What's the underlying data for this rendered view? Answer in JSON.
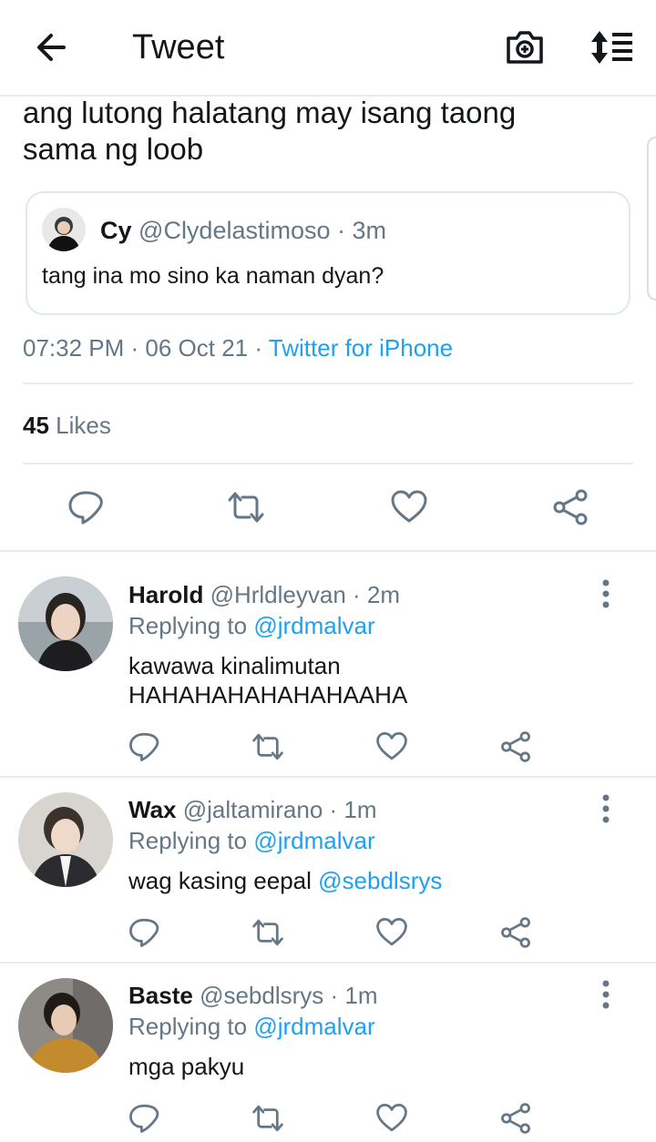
{
  "header": {
    "title": "Tweet"
  },
  "tweet": {
    "text_line1": "ang lutong halatang may isang taong",
    "text_line2": "sama ng loob",
    "quote": {
      "name": "Cy",
      "handle": "@Clydelastimoso",
      "time": "· 3m",
      "text": "tang ina mo sino ka naman dyan?"
    },
    "meta": {
      "time": "07:32 PM · 06 Oct 21 ·",
      "source": "Twitter for iPhone"
    },
    "likes": {
      "count": "45",
      "label": "Likes"
    }
  },
  "replies": [
    {
      "name": "Harold",
      "handle": "@Hrldleyvan",
      "time": "· 2m",
      "replying_label": "Replying to",
      "replying_to": "@jrdmalvar",
      "text_line1": "kawawa kinalimutan",
      "text_line2": "HAHAHAHAHAHAHAAHA"
    },
    {
      "name": "Wax",
      "handle": "@jaltamirano",
      "time": "· 1m",
      "replying_label": "Replying to",
      "replying_to": "@jrdmalvar",
      "text": "wag kasing eepal",
      "mention": "@sebdlsrys"
    },
    {
      "name": "Baste",
      "handle": "@sebdlsrys",
      "time": "· 1m",
      "replying_label": "Replying to",
      "replying_to": "@jrdmalvar",
      "text": "mga pakyu"
    }
  ],
  "colors": {
    "accent": "#1da1f2",
    "muted": "#657786",
    "text": "#14171a",
    "divider": "#e6ecf0"
  },
  "icons": [
    "back-arrow-icon",
    "camera-icon",
    "sort-icon",
    "reply-icon",
    "retweet-icon",
    "like-icon",
    "share-icon",
    "more-icon"
  ]
}
